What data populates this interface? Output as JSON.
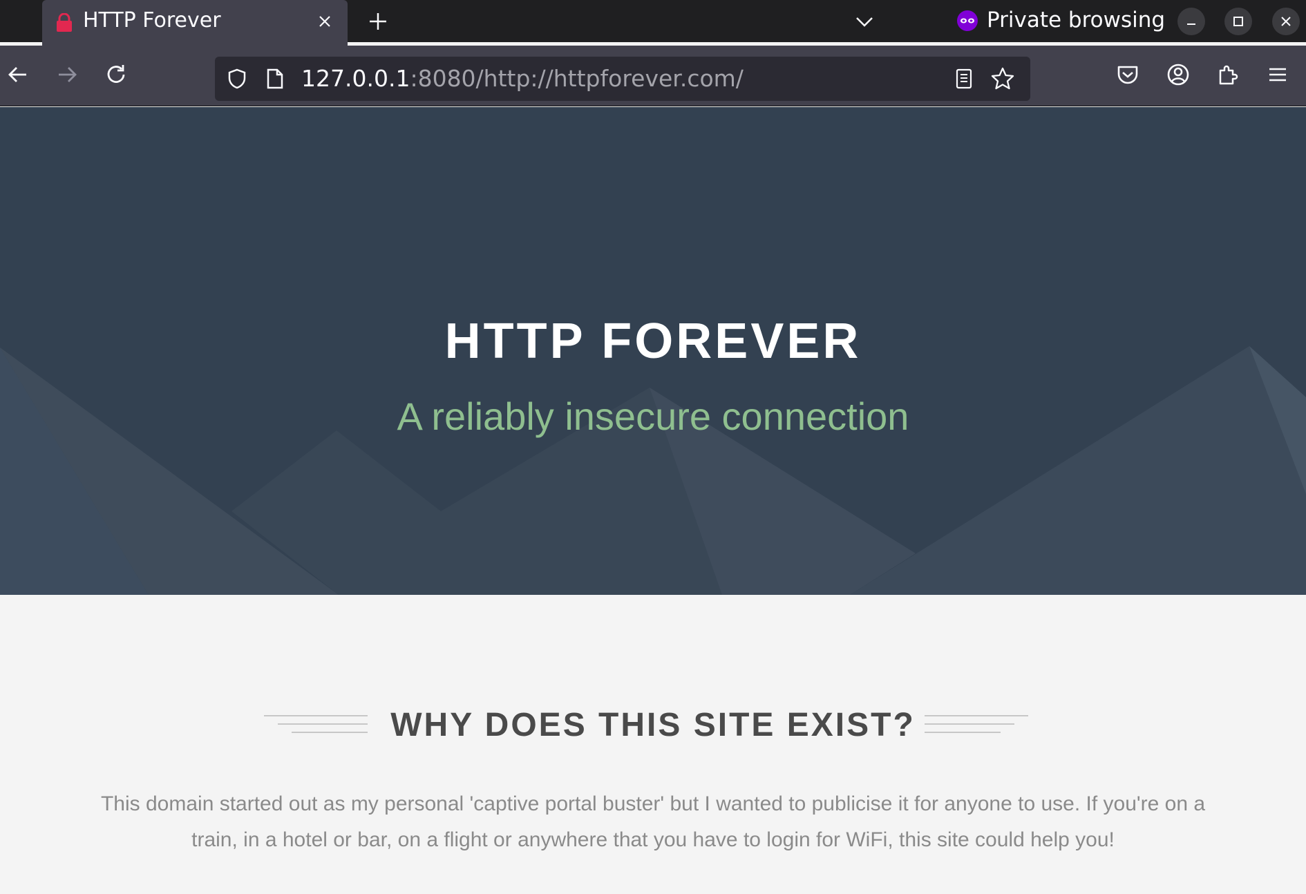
{
  "browser": {
    "tab": {
      "title": "HTTP Forever",
      "icon": "lock-icon"
    },
    "private_label": "Private browsing",
    "url": {
      "host": "127.0.0.1",
      "rest": ":8080/http://httpforever.com/"
    }
  },
  "page": {
    "hero": {
      "title": "HTTP FOREVER",
      "subtitle": "A reliably insecure connection"
    },
    "section": {
      "heading": "WHY DOES THIS SITE EXIST?",
      "body": "This domain started out as my personal 'captive portal buster' but I wanted to publicise it for anyone to use. If you're on a train, in a hotel or bar, on a flight or anywhere that you have to login for WiFi, this site could help you!"
    }
  },
  "colors": {
    "hero_bg": "#334151",
    "subtitle": "#8fbf8f",
    "tab_lock": "#e22850",
    "private_icon": "#8000d7"
  }
}
